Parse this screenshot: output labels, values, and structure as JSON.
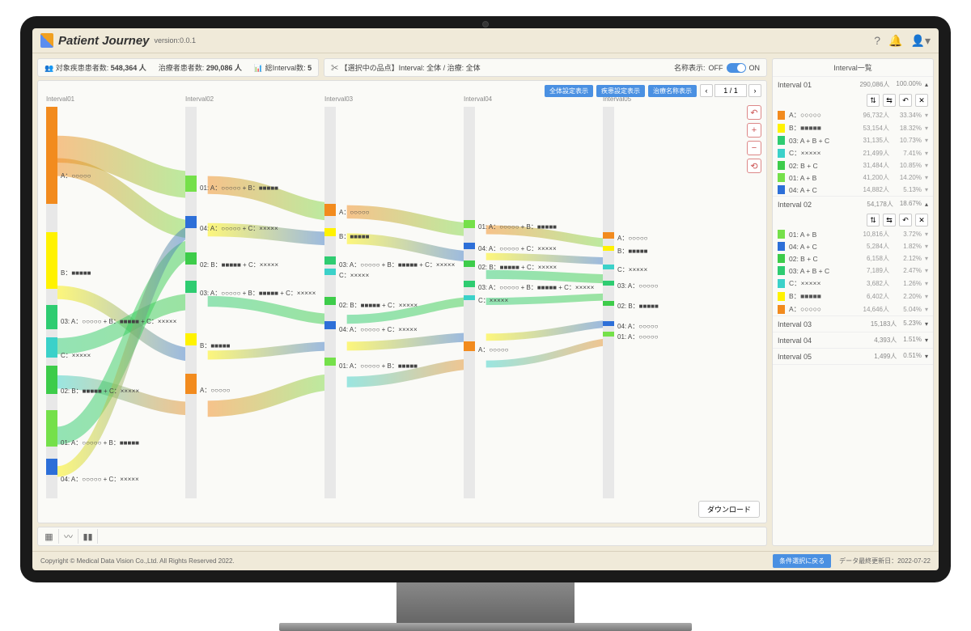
{
  "app": {
    "title": "Patient Journey",
    "version": "version:0.0.1"
  },
  "stats": {
    "s1_lbl": "対象疾患患者数:",
    "s1_val": "548,364 人",
    "s2_lbl": "治療者患者数:",
    "s2_val": "290,086 人",
    "s3_lbl": "総Interval数:",
    "s3_val": "5"
  },
  "header": {
    "selection": "【選択中の品点】Interval: 全体 / 治療: 全体",
    "name_disp": "名称表示:",
    "off": "OFF",
    "on": "ON"
  },
  "btns": {
    "b1": "全体設定表示",
    "b2": "疾患設定表示",
    "b3": "治療名称表示",
    "page": "1 / 1",
    "download": "ダウンロード",
    "cond": "条件選択に戻る"
  },
  "cols": [
    "Interval01",
    "Interval02",
    "Interval03",
    "Interval04",
    "Interval05"
  ],
  "labels": {
    "c1": [
      "A：○○○○○",
      "B：■■■■■",
      "03: A：○○○○○ + B：■■■■■ + C：×××××",
      "C：×××××",
      "02: B：■■■■■ + C：×××××",
      "01: A：○○○○○ + B：■■■■■",
      "04: A：○○○○○ + C：×××××"
    ],
    "c2": [
      "01: A：○○○○○ + B：■■■■■",
      "04: A：○○○○○ + C：×××××",
      "02: B：■■■■■ + C：×××××",
      "03: A：○○○○○ + B：■■■■■ + C：×××××",
      "B：■■■■■",
      "A：○○○○○"
    ],
    "c3": [
      "A：○○○○○",
      "B：■■■■■",
      "03: A：○○○○○ + B：■■■■■ + C：×××××",
      "C：×××××",
      "02: B：■■■■■ + C：×××××",
      "04: A：○○○○○ + C：×××××",
      "01: A：○○○○○ + B：■■■■■"
    ],
    "c4": [
      "01: A：○○○○○ + B：■■■■■",
      "04: A：○○○○○ + C：×××××",
      "02: B：■■■■■ + C：×××××",
      "03: A：○○○○○ + B：■■■■■ + C：×××××",
      "C：×××××",
      "A：○○○○○"
    ],
    "c5": [
      "A：○○○○○",
      "B：■■■■■",
      "C：×××××",
      "03: A：○○○○○",
      "02: B：■■■■■",
      "04: A：○○○○○",
      "01: A：○○○○○"
    ]
  },
  "right": {
    "title": "Interval一覧",
    "intervals": [
      {
        "name": "Interval 01",
        "count": "290,086人",
        "pct": "100.00%",
        "open": true,
        "rows": [
          {
            "c": "#f28b1e",
            "n": "A：○○○○○",
            "v": "96,732人",
            "p": "33.34%"
          },
          {
            "c": "#fff200",
            "n": "B：■■■■■",
            "v": "53,154人",
            "p": "18.32%"
          },
          {
            "c": "#2ecc71",
            "n": "03: A + B + C",
            "v": "31,135人",
            "p": "10.73%"
          },
          {
            "c": "#3bd1c9",
            "n": "C：×××××",
            "v": "21,499人",
            "p": "7.41%"
          },
          {
            "c": "#3dcc4a",
            "n": "02: B + C",
            "v": "31,484人",
            "p": "10.85%"
          },
          {
            "c": "#75e04a",
            "n": "01: A + B",
            "v": "41,200人",
            "p": "14.20%"
          },
          {
            "c": "#2d6fd8",
            "n": "04: A + C",
            "v": "14,882人",
            "p": "5.13%"
          }
        ]
      },
      {
        "name": "Interval 02",
        "count": "54,178人",
        "pct": "18.67%",
        "open": true,
        "rows": [
          {
            "c": "#75e04a",
            "n": "01: A + B",
            "v": "10,816人",
            "p": "3.72%"
          },
          {
            "c": "#2d6fd8",
            "n": "04: A + C",
            "v": "5,284人",
            "p": "1.82%"
          },
          {
            "c": "#3dcc4a",
            "n": "02: B + C",
            "v": "6,158人",
            "p": "2.12%"
          },
          {
            "c": "#2ecc71",
            "n": "03: A + B + C",
            "v": "7,189人",
            "p": "2.47%"
          },
          {
            "c": "#3bd1c9",
            "n": "C：×××××",
            "v": "3,682人",
            "p": "1.26%"
          },
          {
            "c": "#fff200",
            "n": "B：■■■■■",
            "v": "6,402人",
            "p": "2.20%"
          },
          {
            "c": "#f28b1e",
            "n": "A：○○○○○",
            "v": "14,646人",
            "p": "5.04%"
          }
        ]
      },
      {
        "name": "Interval 03",
        "count": "15,183人",
        "pct": "5.23%",
        "open": false
      },
      {
        "name": "Interval 04",
        "count": "4,393人",
        "pct": "1.51%",
        "open": false
      },
      {
        "name": "Interval 05",
        "count": "1,499人",
        "pct": "0.51%",
        "open": false
      }
    ]
  },
  "footer": {
    "copy": "Copyright © Medical Data Vision Co.,Ltd. All Rights Reserved 2022.",
    "update": "データ最終更新日：2022-07-22"
  },
  "chart_data": {
    "type": "sankey",
    "nodes_per_stage": 5,
    "stages": [
      "Interval01",
      "Interval02",
      "Interval03",
      "Interval04",
      "Interval05"
    ],
    "stage_counts": [
      290086,
      54178,
      15183,
      4393,
      1499
    ],
    "interval01": [
      {
        "label": "A",
        "count": 96732,
        "pct": 33.34
      },
      {
        "label": "B",
        "count": 53154,
        "pct": 18.32
      },
      {
        "label": "03:A+B+C",
        "count": 31135,
        "pct": 10.73
      },
      {
        "label": "C",
        "count": 21499,
        "pct": 7.41
      },
      {
        "label": "02:B+C",
        "count": 31484,
        "pct": 10.85
      },
      {
        "label": "01:A+B",
        "count": 41200,
        "pct": 14.2
      },
      {
        "label": "04:A+C",
        "count": 14882,
        "pct": 5.13
      }
    ],
    "interval02": [
      {
        "label": "01:A+B",
        "count": 10816,
        "pct": 3.72
      },
      {
        "label": "04:A+C",
        "count": 5284,
        "pct": 1.82
      },
      {
        "label": "02:B+C",
        "count": 6158,
        "pct": 2.12
      },
      {
        "label": "03:A+B+C",
        "count": 7189,
        "pct": 2.47
      },
      {
        "label": "C",
        "count": 3682,
        "pct": 1.26
      },
      {
        "label": "B",
        "count": 6402,
        "pct": 2.2
      },
      {
        "label": "A",
        "count": 14646,
        "pct": 5.04
      }
    ]
  }
}
